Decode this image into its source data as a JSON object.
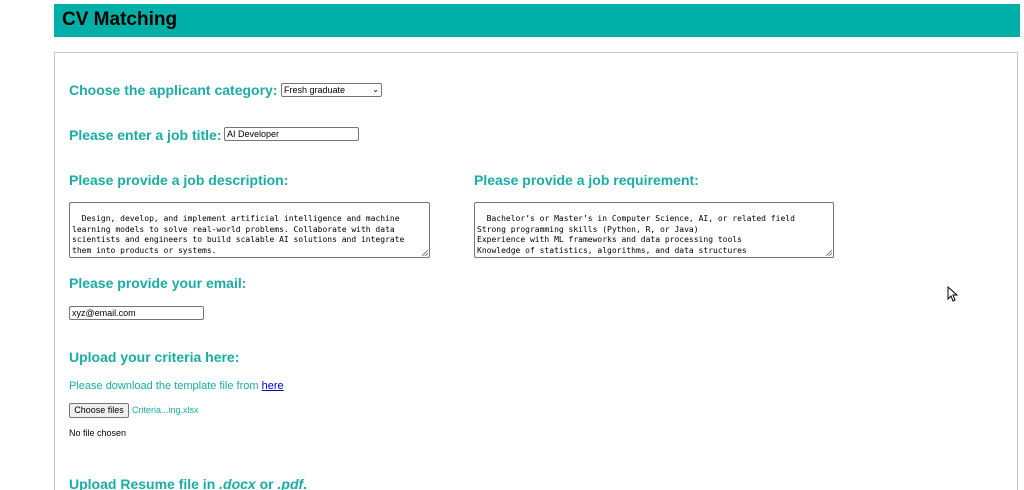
{
  "header": {
    "title": "CV Matching"
  },
  "form": {
    "category": {
      "label": "Choose the applicant category:",
      "selected": "Fresh graduate"
    },
    "job_title": {
      "label": "Please enter a job title:",
      "value": "AI Developer"
    },
    "job_description": {
      "label": "Please provide a job description:",
      "value": "Design, develop, and implement artificial intelligence and machine learning models to solve real-world problems. Collaborate with data scientists and engineers to build scalable AI solutions and integrate them into products or systems."
    },
    "job_requirement": {
      "label": "Please provide a job requirement:",
      "value": "Bachelor’s or Master’s in Computer Science, AI, or related field\nStrong programming skills (Python, R, or Java)\nExperience with ML frameworks and data processing tools\nKnowledge of statistics, algorithms, and data structures\nProblem-solving and analytical skills"
    },
    "email": {
      "label": "Please provide your email:",
      "value": "xyz@email.com"
    },
    "criteria": {
      "label": "Upload your criteria here:",
      "template_text": "Please download the template file from",
      "template_link": "here",
      "button_label": "Choose files",
      "file_name": "Criteria...ing.xlsx",
      "status": "No file chosen"
    },
    "resume": {
      "label_prefix": "Upload Resume file in ",
      "docx": ".docx",
      "or": " or ",
      "pdf": ".pdf",
      "suffix": "."
    }
  },
  "colors": {
    "header_bg": "#00b0a8",
    "label": "#1aada5",
    "link": "#0000cc"
  },
  "icons": {
    "dropdown": "chevron-down-icon",
    "cursor": "mouse-pointer-icon"
  }
}
